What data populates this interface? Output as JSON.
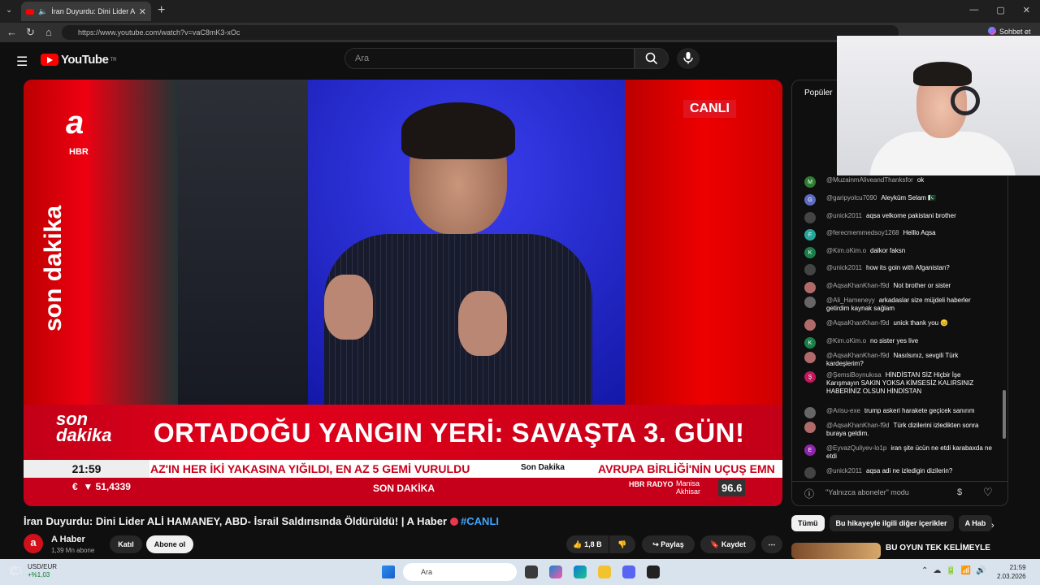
{
  "browser": {
    "tab_title": "İran Duyurdu: Dini Lider ALİ HAMANEY, ABD- İsrail Saldırısında Öldürüldü! | A Haber",
    "url": "https://www.youtube.com/watch?v=vaC8mK3-xOc",
    "copilot_label": "Sohbet et"
  },
  "youtube": {
    "logo_text": "YouTube",
    "region": "TR",
    "search_placeholder": "Ara"
  },
  "video": {
    "channel_overlay_logo": "a",
    "channel_overlay_sub": "HBR",
    "vertical_text": "son dakika",
    "live_badge": "CANLI",
    "banner_tag_line1": "son",
    "banner_tag_line2": "dakika",
    "headline": "ORTADOĞU YANGIN YERİ: SAVAŞTA 3. GÜN!",
    "clock": "21:59",
    "ticker_text": "AZ'IN HER İKİ YAKASINA YIĞILDI, EN AZ 5 GEMİ VURULDU",
    "ticker_tag": "Son Dakika",
    "ticker_text2": "AVRUPA BİRLİĞİ'NİN UÇUŞ EMN",
    "euro_value": "51,4339",
    "bottom_label": "SON DAKİKA",
    "radio_brand": "HBR RADYO",
    "radio_city_line1": "Manisa",
    "radio_city_line2": "Akhisar",
    "radio_freq": "96.6"
  },
  "meta": {
    "title": "İran Duyurdu: Dini Lider ALİ HAMANEY, ABD- İsrail Saldırısında Öldürüldü! | A Haber",
    "live_tag": "#CANLI",
    "channel_name": "A Haber",
    "subscribers": "1,39 Mn abone",
    "join_label": "Katıl",
    "subscribe_label": "Abone ol",
    "like_count": "1,8 B",
    "share_label": "Paylaş",
    "save_label": "Kaydet"
  },
  "chat": {
    "header": "Popüler",
    "messages": [
      {
        "user": "@MuzainmAliveandThanksfor",
        "text": "ok",
        "initial": "M",
        "color": "#2e7d32"
      },
      {
        "user": "@garipyolcu7090",
        "text": "Aleyküm Selam 🇵🇰",
        "initial": "G",
        "color": "#5c6bc0"
      },
      {
        "user": "@unick2011",
        "text": "aqsa velkome pakistani brother",
        "initial": "",
        "color": "#444"
      },
      {
        "user": "@ferecmemmedsoy1268",
        "text": "Helllo Aqsa",
        "initial": "F",
        "color": "#26a69a"
      },
      {
        "user": "@Kim.oKim.o",
        "text": "dalkor faksn",
        "initial": "K",
        "color": "#1b7f4a"
      },
      {
        "user": "@unick2011",
        "text": "how its goin with Afganistan?",
        "initial": "",
        "color": "#444"
      },
      {
        "user": "@AqsaKhanKhan-f9d",
        "text": "Not brother or sister",
        "initial": "",
        "color": "#b06a6a"
      },
      {
        "user": "@Ali_Hameneyy",
        "text": "arkadaslar size müjdeli haberler getirdim kaynak sağlam",
        "initial": "",
        "color": "#666"
      },
      {
        "user": "@AqsaKhanKhan-f9d",
        "text": "unick thank you 😊",
        "initial": "",
        "color": "#b06a6a"
      },
      {
        "user": "@Kim.oKim.o",
        "text": "no sister yes live",
        "initial": "K",
        "color": "#1b7f4a"
      },
      {
        "user": "@AqsaKhanKhan-f9d",
        "text": "Nasılsınız, sevgili Türk kardeşlerim?",
        "initial": "",
        "color": "#b06a6a"
      },
      {
        "user": "@ŞemsiBoynukısa",
        "text": "HİNDİSTAN SİZ Hiçbir İşe Karışmayın SAKIN YOKSA KİMSESİZ KALIRSINIZ HABERİNİZ OLSUN HİNDİSTAN",
        "initial": "Ş",
        "color": "#c2185b"
      },
      {
        "user": "@Arisu-exe",
        "text": "trump askeri harakete geçicek sanırım",
        "initial": "",
        "color": "#666"
      },
      {
        "user": "@AqsaKhanKhan-f9d",
        "text": "Türk dizilerini izledikten sonra buraya geldim.",
        "initial": "",
        "color": "#b06a6a"
      },
      {
        "user": "@EyvazQuliyev-lo1p",
        "text": "iran şite ücün ne etdi karabaxda ne etdi",
        "initial": "E",
        "color": "#8e24aa"
      },
      {
        "user": "@unick2011",
        "text": "aqsa adi ne izledigin dizilerin?",
        "initial": "",
        "color": "#444"
      }
    ],
    "mode_label": "\"Yalnızca aboneler\" modu"
  },
  "chips": [
    "Tümü",
    "Bu hikayeyle ilgili diğer içerikler",
    "A Hab"
  ],
  "recommended": {
    "title": "BU OYUN TEK KELİMEYLE"
  },
  "taskbar": {
    "widget_label": "USD/EUR",
    "widget_change": "+%1,03",
    "search_label": "Ara",
    "time": "21:59",
    "date": "2.03.2026"
  }
}
